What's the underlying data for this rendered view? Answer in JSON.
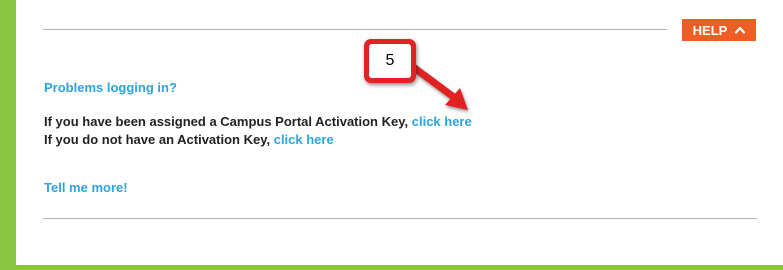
{
  "help": {
    "label": "HELP"
  },
  "heading": "Problems logging in?",
  "activation_line": {
    "text": "If you have been assigned a Campus Portal Activation Key,",
    "link": "click here"
  },
  "no_activation_line": {
    "text": "If you do not have an Activation Key,",
    "link": "click here"
  },
  "tell_more": "Tell me more!",
  "callout": {
    "number": "5"
  },
  "colors": {
    "frame_green": "#8bc53f",
    "help_orange": "#ef5d25",
    "link_blue": "#2ea3dd",
    "callout_red": "#e02424"
  },
  "icons": {
    "help_toggle": "chevron-up-icon",
    "annotation": "arrow-icon"
  }
}
